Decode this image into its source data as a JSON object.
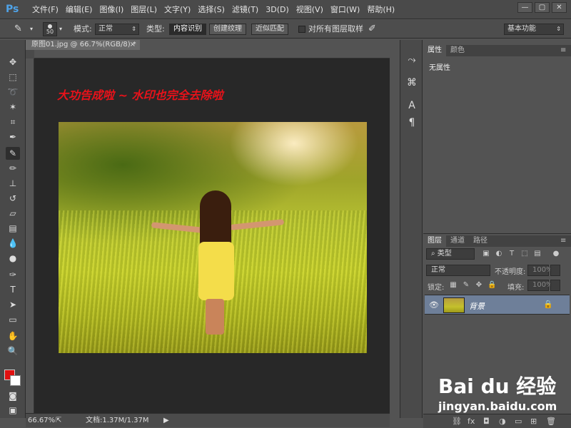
{
  "app": {
    "logo": "Ps"
  },
  "menu": [
    "文件(F)",
    "编辑(E)",
    "图像(I)",
    "图层(L)",
    "文字(Y)",
    "选择(S)",
    "滤镜(T)",
    "3D(D)",
    "视图(V)",
    "窗口(W)",
    "帮助(H)"
  ],
  "window_buttons": {
    "minimize": "—",
    "maximize": "▢",
    "close": "✕"
  },
  "options": {
    "brush_size": "50",
    "mode_label": "模式:",
    "mode_value": "正常",
    "type_label": "类型:",
    "type_options": [
      "内容识别",
      "创建纹理",
      "近似匹配"
    ],
    "type_selected": "内容识别",
    "sample_all_label": "对所有图层取样",
    "workspace": "基本功能"
  },
  "document": {
    "tab_title": "原图01.jpg @ 66.7%(RGB/8) *",
    "tab_close": "×",
    "overlay_text": "大功告成啦 ~ 水印也完全去除啦",
    "zoom": "66.67%",
    "doc_size": "文档:1.37M/1.37M"
  },
  "properties_panel": {
    "tabs": [
      "属性",
      "颜色"
    ],
    "empty_text": "无属性"
  },
  "layers_panel": {
    "tabs": [
      "图层",
      "通道",
      "路径"
    ],
    "filter_kind": "类型",
    "blend_mode": "正常",
    "opacity_label": "不透明度:",
    "opacity_value": "100%",
    "lock_label": "锁定:",
    "fill_label": "填充:",
    "fill_value": "100%",
    "layers": [
      {
        "name": "背景",
        "visible": true,
        "locked": true
      }
    ]
  },
  "watermark": {
    "brand": "Bai du 经验",
    "url": "jingyan.baidu.com"
  },
  "colors": {
    "foreground": "#e01010",
    "background": "#ffffff",
    "overlay_text": "#e8121a",
    "selected_layer": "#6e7f99"
  }
}
